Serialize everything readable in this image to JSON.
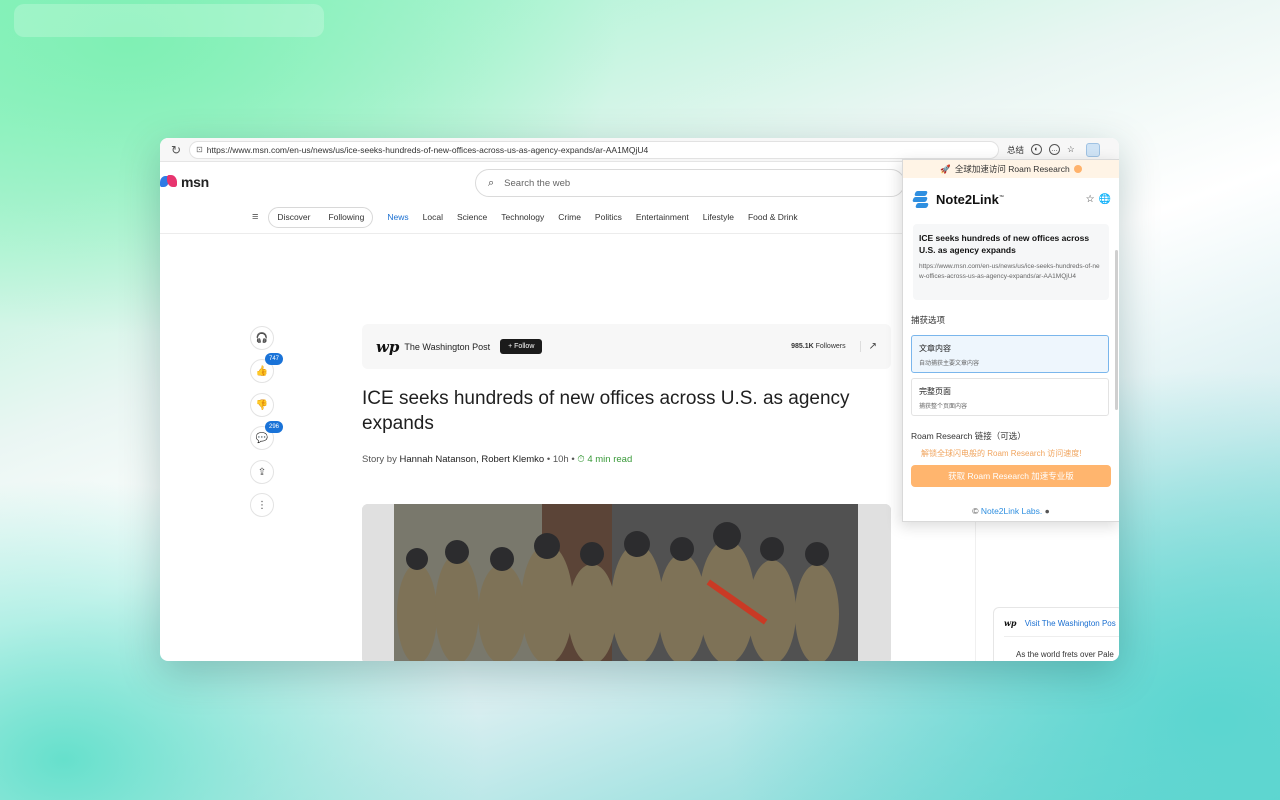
{
  "browser": {
    "url": "https://www.msn.com/en-us/news/us/ice-seeks-hundreds-of-new-offices-across-us-as-agency-expands/ar-AA1MQjU4",
    "summary_label": "总结"
  },
  "msn": {
    "logo_text": "msn",
    "search_placeholder": "Search the web",
    "nav_pills": [
      "Discover",
      "Following"
    ],
    "nav_items": [
      "News",
      "Local",
      "Science",
      "Technology",
      "Crime",
      "Politics",
      "Entertainment",
      "Lifestyle",
      "Food & Drink"
    ],
    "active_nav": "News"
  },
  "rail": {
    "like_count": "747",
    "comment_count": "296"
  },
  "article": {
    "publisher_logo": "wp",
    "publisher": "The Washington Post",
    "follow_label": "+ Follow",
    "followers_count": "985.1K",
    "followers_label": "Followers",
    "headline": "ICE seeks hundreds of new offices across U.S. as agency expands",
    "byline_prefix": "Story by",
    "authors": "Hannah Natanson, Robert Klemko",
    "age": "10h",
    "separator": "•",
    "read_time": "4 min read"
  },
  "promo": {
    "logo": "wp",
    "title": "Visit The Washington Pos",
    "text": "As the world frets over Pale"
  },
  "extension": {
    "banner": "全球加速访问 Roam Research",
    "name": "Note2Link",
    "tm": "™",
    "article_title": "ICE seeks hundreds of new offices across U.S. as agency expands",
    "article_url": "https://www.msn.com/en-us/news/us/ice-seeks-hundreds-of-new-offices-across-us-as-agency-expands/ar-AA1MQjU4",
    "capture_label": "捕获选项",
    "options": [
      {
        "title": "文章内容",
        "desc": "自动捕获主要文章内容",
        "selected": true
      },
      {
        "title": "完整页面",
        "desc": "捕获整个页面内容",
        "selected": false
      }
    ],
    "link_label": "Roam Research 链接（可选）",
    "link_hint": "解锁全球闪电般的 Roam Research 访问速度!",
    "cta": "获取 Roam Research 加速专业版",
    "footer_prefix": "©",
    "footer_lab": "Note2Link Labs.",
    "accent_color": "#2f8fe0",
    "cta_color": "#ffb56e"
  }
}
